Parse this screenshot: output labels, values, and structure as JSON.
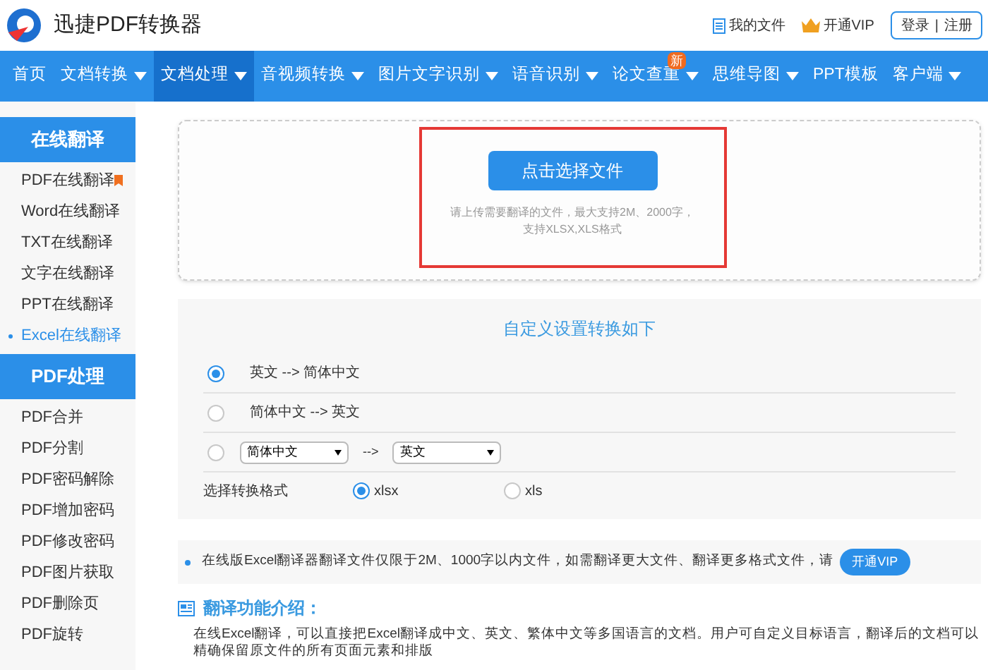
{
  "header": {
    "brand": "迅捷PDF转换器",
    "links": [
      {
        "kind": "files",
        "label": "我的文件"
      },
      {
        "kind": "vip",
        "label": "开通VIP"
      }
    ],
    "auth": {
      "login": "登录",
      "separator": "|",
      "register": "注册"
    }
  },
  "nav": [
    {
      "label": "首页",
      "has_menu": false,
      "selected": false
    },
    {
      "label": "文档转换",
      "has_menu": true,
      "selected": false
    },
    {
      "label": "文档处理",
      "has_menu": true,
      "selected": true
    },
    {
      "label": "音视频转换",
      "has_menu": true,
      "selected": false
    },
    {
      "label": "图片文字识别",
      "has_menu": true,
      "selected": false
    },
    {
      "label": "语音识别",
      "has_menu": true,
      "selected": false
    },
    {
      "label": "论文查重",
      "has_menu": true,
      "selected": false,
      "badge": "新"
    },
    {
      "label": "思维导图",
      "has_menu": true,
      "selected": false
    },
    {
      "label": "PPT模板",
      "has_menu": false,
      "selected": false
    },
    {
      "label": "客户端",
      "has_menu": true,
      "selected": false
    }
  ],
  "sidebar": [
    {
      "title": "在线翻译",
      "items": [
        {
          "label": "PDF在线翻译",
          "selected": false,
          "flag": true
        },
        {
          "label": "Word在线翻译",
          "selected": false,
          "flag": false
        },
        {
          "label": "TXT在线翻译",
          "selected": false,
          "flag": false
        },
        {
          "label": "文字在线翻译",
          "selected": false,
          "flag": false
        },
        {
          "label": "PPT在线翻译",
          "selected": false,
          "flag": false
        },
        {
          "label": "Excel在线翻译",
          "selected": true,
          "flag": false
        }
      ]
    },
    {
      "title": "PDF处理",
      "items": [
        {
          "label": "PDF合并",
          "selected": false,
          "flag": false
        },
        {
          "label": "PDF分割",
          "selected": false,
          "flag": false
        },
        {
          "label": "PDF密码解除",
          "selected": false,
          "flag": false
        },
        {
          "label": "PDF增加密码",
          "selected": false,
          "flag": false
        },
        {
          "label": "PDF修改密码",
          "selected": false,
          "flag": false
        },
        {
          "label": "PDF图片获取",
          "selected": false,
          "flag": false
        },
        {
          "label": "PDF删除页",
          "selected": false,
          "flag": false
        },
        {
          "label": "PDF旋转",
          "selected": false,
          "flag": false
        }
      ]
    }
  ],
  "upload": {
    "button": "点击选择文件",
    "hint_lines": [
      "请上传需要翻译的文件，最大支持2M、2000字，",
      "支持XLSX,XLS格式"
    ],
    "highlighted": true
  },
  "settings": {
    "title": "自定义设置转换如下",
    "options": [
      {
        "kind": "preset",
        "label": "英文 --> 简体中文",
        "selected": true
      },
      {
        "kind": "preset",
        "label": "简体中文 --> 英文",
        "selected": false
      },
      {
        "kind": "custom",
        "from": "简体中文",
        "arrow": "-->",
        "to": "英文",
        "selected": false
      }
    ],
    "format_label": "选择转换格式",
    "formats": [
      {
        "label": "xlsx",
        "selected": true
      },
      {
        "label": "xls",
        "selected": false
      }
    ]
  },
  "notice": {
    "text": "在线版Excel翻译器翻译文件仅限于2M、1000字以内文件，如需翻译更大文件、翻译更多格式文件，请",
    "button": "开通VIP"
  },
  "intro": {
    "title": "翻译功能介绍：",
    "text": "在线Excel翻译，可以直接把Excel翻译成中文、英文、繁体中文等多国语言的文档。用户可自定义目标语言，翻译后的文档可以精确保留原文件的所有页面元素和排版"
  }
}
